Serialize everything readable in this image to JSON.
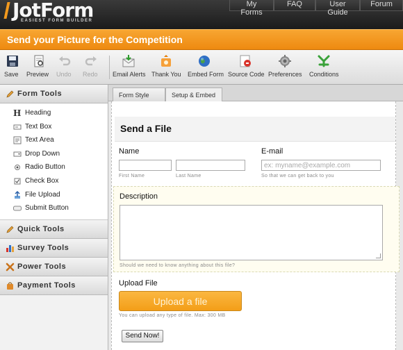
{
  "header": {
    "logo_text": "JotForm",
    "logo_sub": "EASIEST FORM BUILDER",
    "nav": [
      "My Forms",
      "FAQ",
      "User Guide",
      "Forum"
    ]
  },
  "banner": {
    "title": "Send your Picture for the Competition"
  },
  "toolbar": {
    "items": [
      {
        "label": "Save",
        "icon": "floppy-disk-icon"
      },
      {
        "label": "Preview",
        "icon": "preview-icon"
      },
      {
        "label": "Undo",
        "icon": "undo-icon"
      },
      {
        "label": "Redo",
        "icon": "redo-icon"
      },
      {
        "label": "Email Alerts",
        "icon": "email-icon"
      },
      {
        "label": "Thank You",
        "icon": "thank-you-icon"
      },
      {
        "label": "Embed Form",
        "icon": "globe-icon"
      },
      {
        "label": "Source Code",
        "icon": "source-code-icon"
      },
      {
        "label": "Preferences",
        "icon": "gear-icon"
      },
      {
        "label": "Conditions",
        "icon": "conditions-icon"
      }
    ]
  },
  "sidebar": {
    "form_tools_title": "Form Tools",
    "form_tools": [
      "Heading",
      "Text Box",
      "Text Area",
      "Drop Down",
      "Radio Button",
      "Check Box",
      "File Upload",
      "Submit Button"
    ],
    "quick_tools_title": "Quick Tools",
    "survey_tools_title": "Survey Tools",
    "power_tools_title": "Power Tools",
    "payment_tools_title": "Payment Tools"
  },
  "tabs": [
    "Form Style",
    "Setup & Embed"
  ],
  "form": {
    "title": "Send a File",
    "name_label": "Name",
    "first_name_sub": "First Name",
    "last_name_sub": "Last Name",
    "email_label": "E-mail",
    "email_placeholder": "ex: myname@example.com",
    "email_sub": "So that we can get back to you",
    "description_label": "Description",
    "description_sub": "Should we need to know anything about this file?",
    "upload_label": "Upload File",
    "upload_button": "Upload a file",
    "upload_sub": "You can upload any type of file. Max: 300 MB",
    "submit_button": "Send Now!"
  },
  "colors": {
    "accent": "#f39a1e",
    "header_dark": "#222222"
  }
}
